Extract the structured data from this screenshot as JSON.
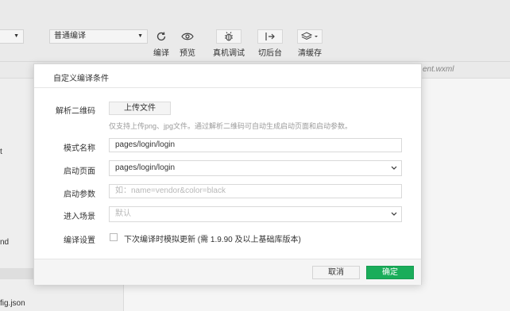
{
  "toolbar": {
    "mode_select": {
      "value": ""
    },
    "compile_select": {
      "value": "普通编译"
    },
    "buttons": [
      {
        "icon": "refresh-icon",
        "label": "编译"
      },
      {
        "icon": "eye-icon",
        "label": "预览"
      },
      {
        "icon": "bug-icon",
        "label": "真机调试"
      },
      {
        "icon": "switch-arrow-icon",
        "label": "切后台"
      },
      {
        "icon": "layers-icon",
        "label": "清缓存"
      }
    ]
  },
  "editor_tab": {
    "file": "ent.wxml"
  },
  "left_panel": {
    "items": [
      "t",
      "nd",
      "fig.json"
    ]
  },
  "dialog": {
    "title": "自定义编译条件",
    "qr": {
      "label": "解析二维码",
      "upload_button": "上传文件",
      "hint": "仅支持上传png、jpg文件。通过解析二维码可自动生成启动页面和启动参数。"
    },
    "mode_name": {
      "label": "模式名称",
      "value": "pages/login/login"
    },
    "start_page": {
      "label": "启动页面",
      "value": "pages/login/login"
    },
    "start_params": {
      "label": "启动参数",
      "placeholder": "如：name=vendor&color=black"
    },
    "scene": {
      "label": "进入场景",
      "placeholder": "默认"
    },
    "compile_settings": {
      "label": "编译设置",
      "checkbox_label": "下次编译时模拟更新 (需 1.9.90 及以上基础库版本)",
      "checked": false
    },
    "cancel_button": "取消",
    "confirm_button": "确定"
  },
  "colors": {
    "primary_green": "#1aad5a"
  }
}
